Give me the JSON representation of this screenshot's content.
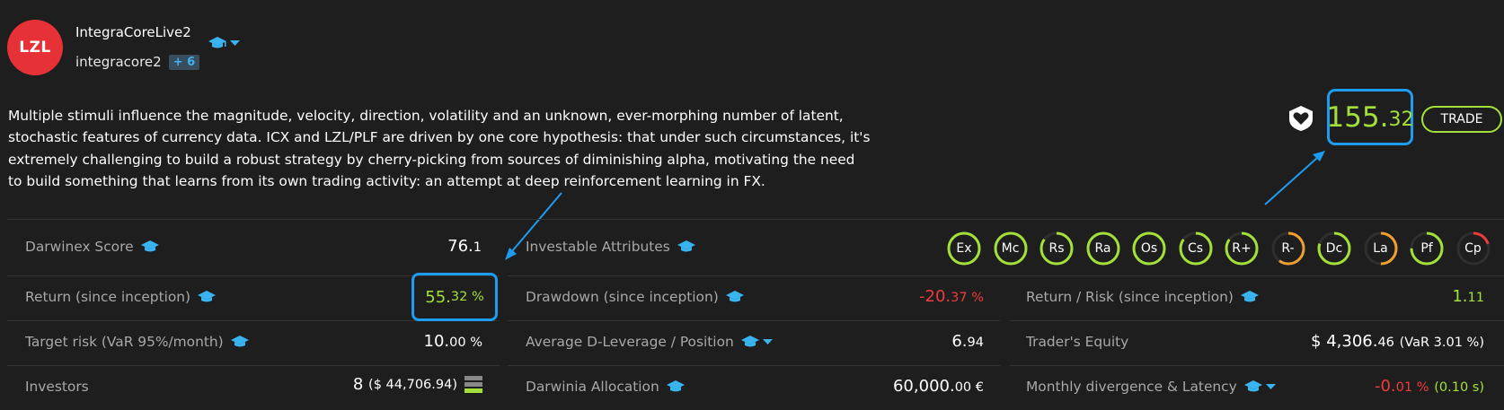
{
  "header": {
    "logo_text": "LZL",
    "name": "IntegraCoreLive2",
    "username": "integracore2",
    "badge": "+ 6"
  },
  "description": "Multiple stimuli influence the magnitude, velocity, direction, volatility and an unknown, ever-morphing number of latent, stochastic features of currency data. ICX and LZL/PLF are driven by one core hypothesis: that under such circumstances, it's extremely challenging to build a robust strategy by cherry-picking from sources of diminishing alpha, motivating the need to build something that learns from its own trading activity: an attempt at deep reinforcement learning in FX.",
  "price": {
    "int": "155.",
    "dec": "32"
  },
  "trade_label": "TRADE",
  "stats": {
    "darwinex_score": {
      "label": "Darwinex Score",
      "int": "76.",
      "dec": "1"
    },
    "investable_attributes": {
      "label": "Investable Attributes"
    },
    "return": {
      "label": "Return (since inception)",
      "int": "55.",
      "dec": "32 %"
    },
    "drawdown": {
      "label": "Drawdown (since inception)",
      "int": "-20.",
      "dec": "37 %"
    },
    "return_risk": {
      "label": "Return / Risk (since inception)",
      "int": "1.",
      "dec": "11"
    },
    "target_risk": {
      "label": "Target risk (VaR 95%/month)",
      "int": "10.",
      "dec": "00 %"
    },
    "avg_leverage": {
      "label": "Average D-Leverage / Position",
      "int": "6.",
      "dec": "94"
    },
    "traders_equity": {
      "label": "Trader's Equity",
      "int": "$ 4,306.",
      "dec": "46",
      "extra": "(VaR 3.01 %)"
    },
    "investors": {
      "label": "Investors",
      "int": "8",
      "extra": "($ 44,706.94)"
    },
    "darwinia": {
      "label": "Darwinia Allocation",
      "int": "60,000.",
      "dec": "00 €"
    },
    "divergence": {
      "label": "Monthly divergence & Latency",
      "int": "-0.",
      "dec": "01 %",
      "extra": "(0.10 s)"
    }
  },
  "attributes": [
    {
      "code": "Ex",
      "level": 1.0,
      "color": "#a4e03a"
    },
    {
      "code": "Mc",
      "level": 1.0,
      "color": "#a4e03a"
    },
    {
      "code": "Rs",
      "level": 0.85,
      "color": "#a4e03a"
    },
    {
      "code": "Ra",
      "level": 1.0,
      "color": "#a4e03a"
    },
    {
      "code": "Os",
      "level": 1.0,
      "color": "#a4e03a"
    },
    {
      "code": "Cs",
      "level": 0.85,
      "color": "#a4e03a"
    },
    {
      "code": "R+",
      "level": 0.85,
      "color": "#a4e03a"
    },
    {
      "code": "R-",
      "level": 0.6,
      "color": "#f0a030"
    },
    {
      "code": "Dc",
      "level": 0.8,
      "color": "#a4e03a"
    },
    {
      "code": "La",
      "level": 0.5,
      "color": "#f0a030"
    },
    {
      "code": "Pf",
      "level": 0.75,
      "color": "#a4e03a"
    },
    {
      "code": "Cp",
      "level": 0.2,
      "color": "#ef3b3b"
    }
  ],
  "colors": {
    "accent": "#1e9cf0",
    "positive": "#a4e03a",
    "negative": "#ef3b3b",
    "warning": "#f0a030"
  },
  "icons": [
    "graduation-cap-icon",
    "chevron-down-icon",
    "heart-icon",
    "bars-icon"
  ]
}
